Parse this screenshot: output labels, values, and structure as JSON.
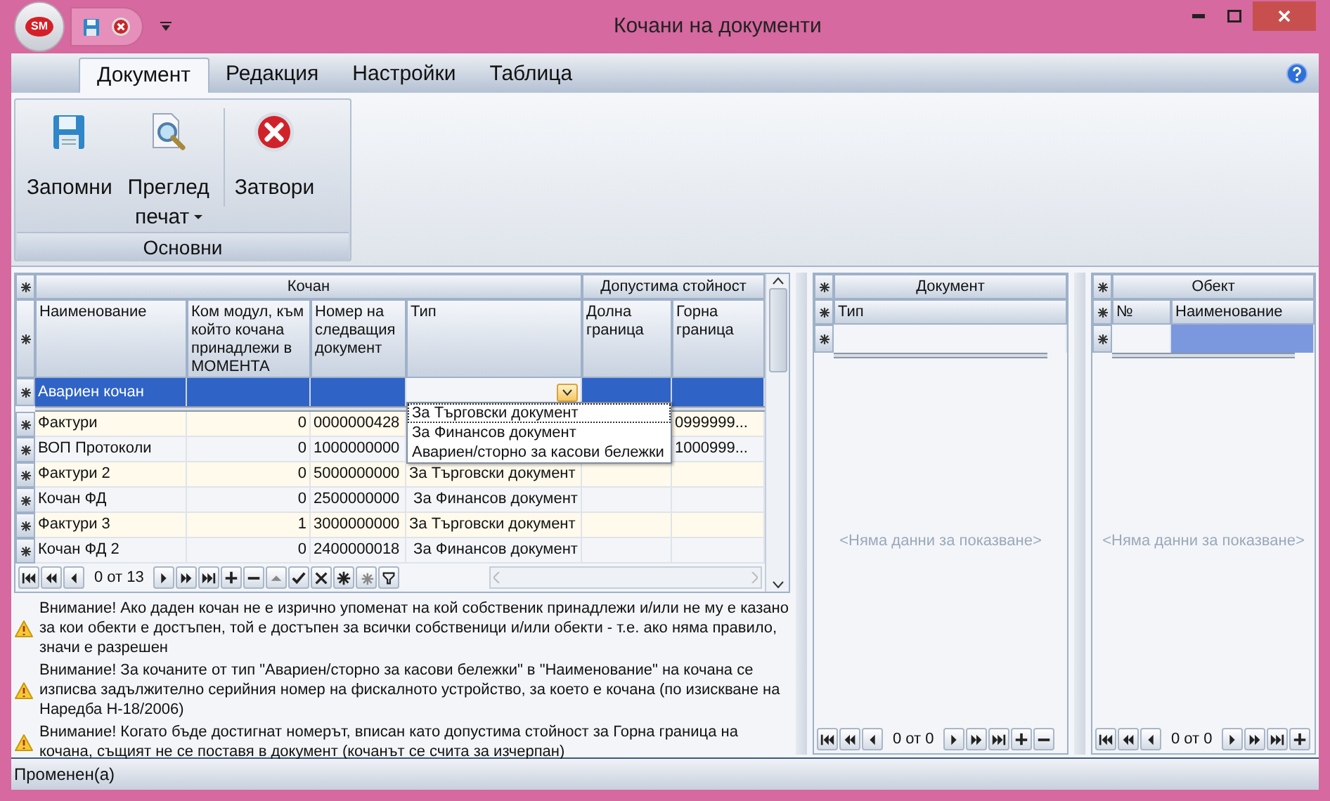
{
  "window": {
    "logo": "SM",
    "title": "Кочани на документи"
  },
  "ribbon": {
    "tabs": [
      {
        "label": "Документ",
        "selected": true
      },
      {
        "label": "Редакция",
        "selected": false
      },
      {
        "label": "Настройки",
        "selected": false
      },
      {
        "label": "Таблица",
        "selected": false
      }
    ],
    "groups": [
      {
        "label": "Основни",
        "buttons": [
          {
            "label": "Запомни",
            "kind": "save",
            "has_menu": false
          },
          {
            "label": "Преглед печат",
            "kind": "preview",
            "has_menu": true
          },
          {
            "label": "Затвори",
            "kind": "close",
            "has_menu": false
          }
        ]
      }
    ]
  },
  "grid": {
    "bands": [
      {
        "label": "Кочан"
      },
      {
        "label": "Допустима стойност"
      }
    ],
    "columns": [
      "Наименование",
      "Ком модул, към който кочана принадлежи в МОМЕНТА",
      "Номер на следващия документ",
      "Тип",
      "Долна граница",
      "Горна граница"
    ],
    "new_row": {
      "name": "Авариен кочан",
      "selected": true
    },
    "rows": [
      {
        "name": "Фактури",
        "module": "0",
        "number": "0000000428",
        "upper": "0999999..."
      },
      {
        "name": "ВОП Протоколи",
        "module": "0",
        "number": "1000000000",
        "upper": "1000999..."
      },
      {
        "name": "Фактури 2",
        "module": "0",
        "number": "5000000000",
        "type": "За Търговски документ"
      },
      {
        "name": "Кочан ФД",
        "module": "0",
        "number": "2500000000",
        "type": " За Финансов документ"
      },
      {
        "name": "Фактури 3",
        "module": "1",
        "number": "3000000000",
        "type": "За Търговски документ"
      },
      {
        "name": "Кочан ФД 2",
        "module": "0",
        "number": "2400000018",
        "type": " За Финансов документ"
      }
    ],
    "type_dropdown": {
      "options": [
        {
          "label": "За Търговски документ",
          "selected": true
        },
        {
          "label": "За Финансов документ",
          "selected": false
        },
        {
          "label": "Авариен/сторно за касови бележки",
          "selected": false
        }
      ]
    },
    "navigator": "0 от 13"
  },
  "warnings": [
    "Внимание! Ако даден кочан не е изрично упоменат на кой собственик принадлежи и/или не му е казано за кои обекти е достъпен, той е достъпен за всички собственици и/или обекти - т.е. ако няма правило, значи е разрешен",
    "Внимание! За кочаните от тип \"Авариен/сторно за касови бележки\" в \"Наименование\" на кочана се изписва задължително серийния номер на фискалното устройство, за което е кочана (по изискване на Наредба Н-18/2006)",
    "Внимание! Когато бъде достигнат номерът, вписан като допустима стойност за Горна граница на кочана, същият не се поставя в документ (кочанът се счита за изчерпан)"
  ],
  "document_panel": {
    "band": "Документ",
    "columns": [
      "Тип"
    ],
    "empty_text": "<Няма данни за показване>",
    "navigator": "0 от 0"
  },
  "object_panel": {
    "band": "Обект",
    "columns": [
      "№",
      "Наименование"
    ],
    "empty_text": "<Няма данни за показване>",
    "navigator": "0 от 0"
  },
  "status_bar": "Променен(а)"
}
